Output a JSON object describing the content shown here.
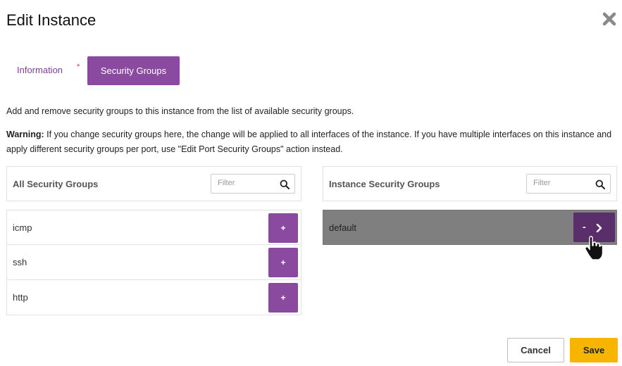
{
  "modal": {
    "title": "Edit Instance",
    "close_icon": "close-x-icon"
  },
  "tabs": [
    {
      "label": "Information",
      "required_marker": "*",
      "active": false
    },
    {
      "label": "Security Groups",
      "active": true
    }
  ],
  "description": "Add and remove security groups to this instance from the list of available security groups.",
  "warning": {
    "label": "Warning:",
    "text": " If you change security groups here, the change will be applied to all interfaces of the instance. If you have multiple interfaces on this instance and apply different security groups per port, use \"Edit Port Security Groups\" action instead."
  },
  "available": {
    "header": "All Security Groups",
    "filter_placeholder": "Filter",
    "filter_icon": "search-icon",
    "items": [
      {
        "name": "icmp",
        "action": "+"
      },
      {
        "name": "ssh",
        "action": "+"
      },
      {
        "name": "http",
        "action": "+"
      }
    ]
  },
  "selected": {
    "header": "Instance Security Groups",
    "filter_placeholder": "Filter",
    "filter_icon": "search-icon",
    "items": [
      {
        "name": "default",
        "action": "-",
        "action_icon": "chevron-right-icon"
      }
    ]
  },
  "footer": {
    "cancel_label": "Cancel",
    "save_label": "Save"
  },
  "colors": {
    "accent": "#8a4a9f",
    "accent_dark": "#5a2d6b",
    "save": "#f7b500",
    "selected_row": "#7f7f7f"
  }
}
